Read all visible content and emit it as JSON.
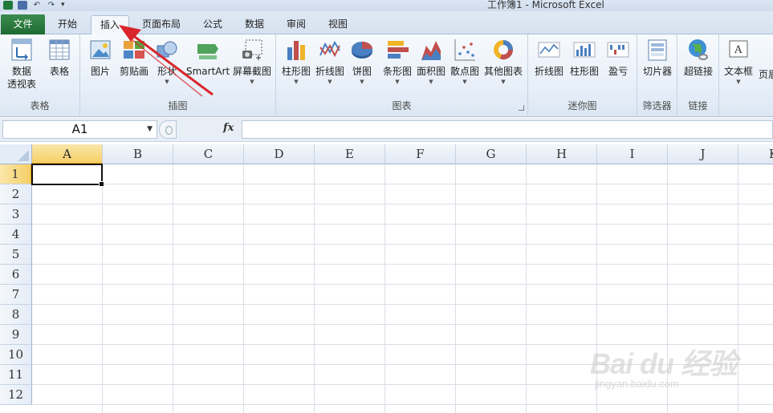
{
  "window": {
    "title": "工作簿1 - Microsoft Excel"
  },
  "tabs": [
    {
      "label": "文件"
    },
    {
      "label": "开始"
    },
    {
      "label": "插入"
    },
    {
      "label": "页面布局"
    },
    {
      "label": "公式"
    },
    {
      "label": "数据"
    },
    {
      "label": "审阅"
    },
    {
      "label": "视图"
    }
  ],
  "ribbon": {
    "groups": {
      "tables": "表格",
      "illustrations": "插图",
      "charts": "图表",
      "sparklines": "迷你图",
      "filter": "筛选器",
      "links": "链接"
    },
    "buttons": {
      "pivot_line1": "数据",
      "pivot_line2": "透视表",
      "table": "表格",
      "picture": "图片",
      "clipart": "剪贴画",
      "shapes": "形状",
      "smartart": "SmartArt",
      "screenshot": "屏幕截图",
      "column": "柱形图",
      "line": "折线图",
      "pie": "饼图",
      "bar": "条形图",
      "area": "面积图",
      "scatter": "散点图",
      "other": "其他图表",
      "spark_line": "折线图",
      "spark_column": "柱形图",
      "spark_winloss": "盈亏",
      "slicer": "切片器",
      "hyperlink": "超链接",
      "textbox": "文本框",
      "header": "页眉"
    }
  },
  "formula_bar": {
    "name_box": "A1",
    "fx": "fx",
    "value": ""
  },
  "sheet": {
    "columns": [
      "A",
      "B",
      "C",
      "D",
      "E",
      "F",
      "G",
      "H",
      "I",
      "J",
      "K"
    ],
    "rows": [
      "1",
      "2",
      "3",
      "4",
      "5",
      "6",
      "7",
      "8",
      "9",
      "10",
      "11",
      "12"
    ],
    "active_cell": "A1"
  },
  "watermark": {
    "line1": "Bai du 经验",
    "line2": "jingyan.baidu.com"
  },
  "colors": {
    "file_tab": "#2a7d3f",
    "selection": "#f6cf67",
    "arrow": "#d9262b"
  }
}
